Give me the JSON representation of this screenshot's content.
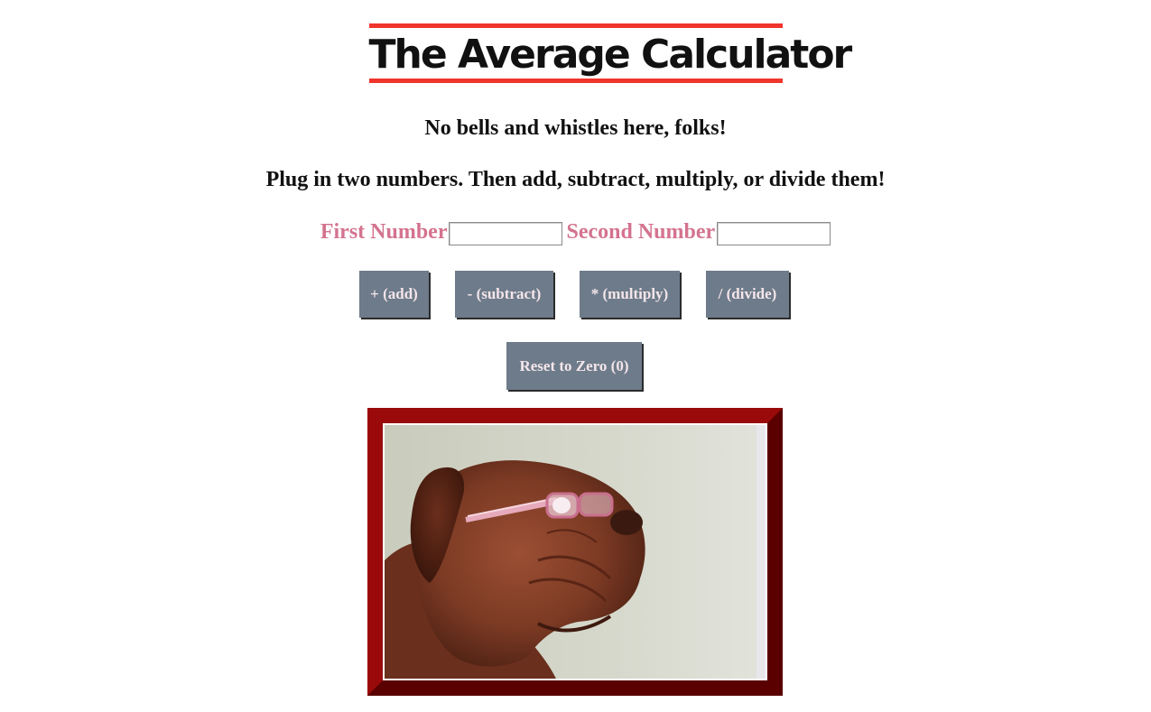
{
  "header": {
    "title": "The Average Calculator"
  },
  "intro": {
    "subtitle": "No bells and whistles here, folks!",
    "instructions": "Plug in two numbers. Then add, subtract, multiply, or divide them!"
  },
  "form": {
    "first_label": "First Number",
    "first_value": "",
    "second_label": "Second Number",
    "second_value": ""
  },
  "buttons": {
    "add": "+ (add)",
    "subtract": "- (subtract)",
    "multiply": "* (multiply)",
    "divide": "/ (divide)",
    "reset": "Reset to Zero (0)"
  },
  "image": {
    "subject": "dog-wearing-pink-glasses",
    "frame_color": "#7a0000"
  },
  "colors": {
    "title_rule": "#f0352c",
    "label": "#d4738f",
    "button_bg": "#6e7b8a",
    "button_text": "#f4e6ea"
  }
}
